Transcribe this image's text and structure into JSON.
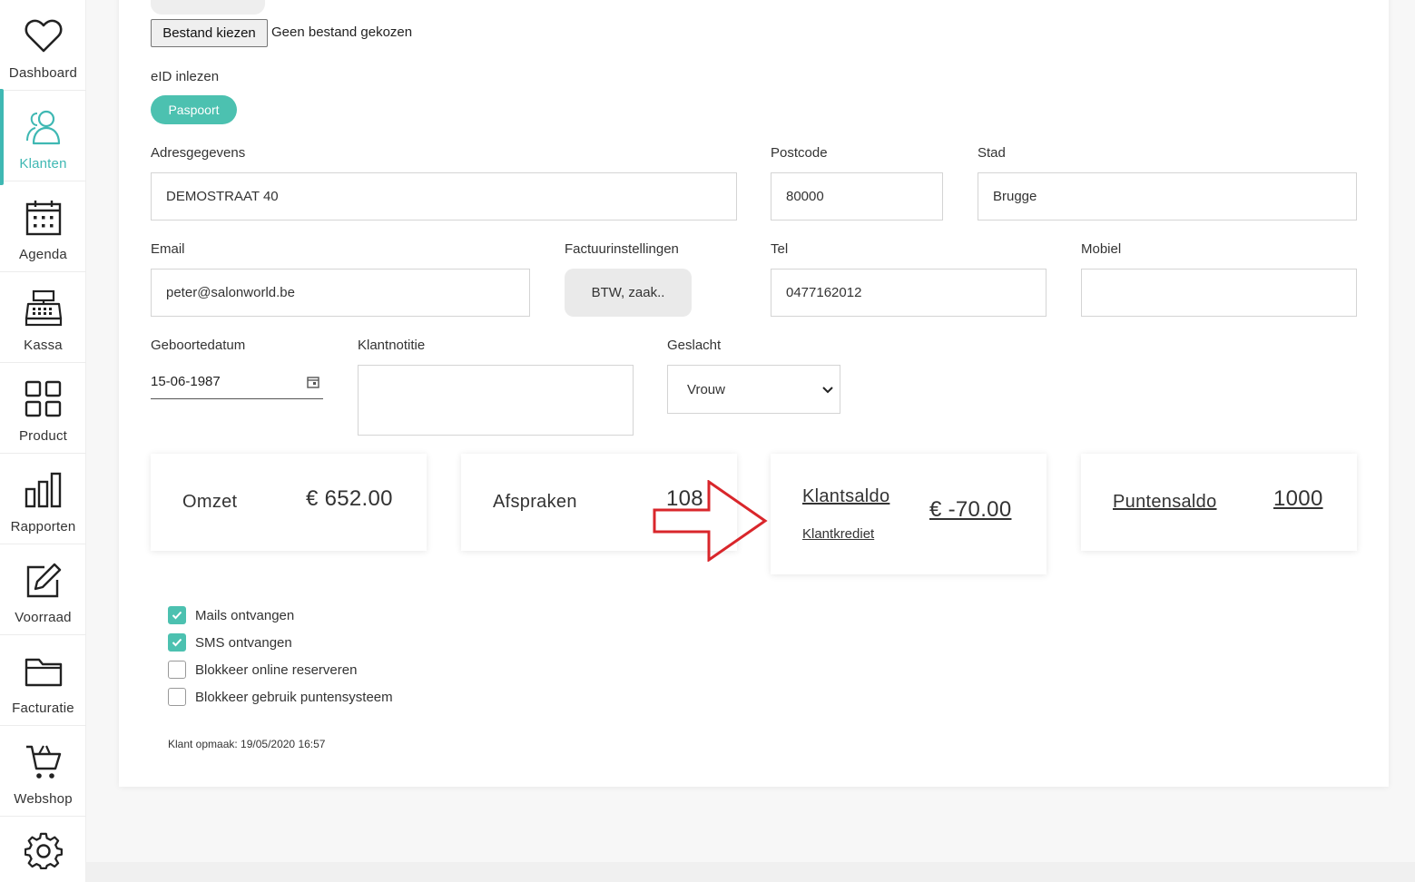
{
  "sidebar": {
    "items": [
      {
        "label": "Dashboard",
        "icon": "heart-icon"
      },
      {
        "label": "Klanten",
        "icon": "users-icon",
        "active": true
      },
      {
        "label": "Agenda",
        "icon": "calendar-icon"
      },
      {
        "label": "Kassa",
        "icon": "cash-register-icon"
      },
      {
        "label": "Product",
        "icon": "grid-icon"
      },
      {
        "label": "Rapporten",
        "icon": "bar-chart-icon"
      },
      {
        "label": "Voorraad",
        "icon": "edit-icon"
      },
      {
        "label": "Facturatie",
        "icon": "folder-icon"
      },
      {
        "label": "Webshop",
        "icon": "cart-icon"
      },
      {
        "label": "",
        "icon": "gear-icon"
      }
    ],
    "accent_color": "#3fb8b3"
  },
  "file_upload": {
    "button_label": "Bestand kiezen",
    "status": "Geen bestand gekozen"
  },
  "eid": {
    "label": "eID inlezen",
    "button_label": "Paspoort",
    "button_color": "#4cc1b0"
  },
  "form": {
    "address_label": "Adresgegevens",
    "address_value": "DEMOSTRAAT 40",
    "postcode_label": "Postcode",
    "postcode_value": "80000",
    "city_label": "Stad",
    "city_value": "Brugge",
    "email_label": "Email",
    "email_value": "peter@salonworld.be",
    "invoice_label": "Factuurinstellingen",
    "invoice_button": "BTW, zaak..",
    "tel_label": "Tel",
    "tel_value": "0477162012",
    "mobile_label": "Mobiel",
    "mobile_value": "",
    "birthdate_label": "Geboortedatum",
    "birthdate_value": "15-06-1987",
    "note_label": "Klantnotitie",
    "note_value": "",
    "gender_label": "Geslacht",
    "gender_value": "Vrouw"
  },
  "stats": {
    "turnover_label": "Omzet",
    "turnover_value": "€ 652.00",
    "appointments_label": "Afspraken",
    "appointments_value": "108",
    "balance_label": "Klantsaldo",
    "balance_value": "€ -70.00",
    "credit_link": "Klantkrediet",
    "points_label": "Puntensaldo",
    "points_value": "1000"
  },
  "options": [
    {
      "label": "Mails ontvangen",
      "checked": true
    },
    {
      "label": "SMS ontvangen",
      "checked": true
    },
    {
      "label": "Blokkeer online reserveren",
      "checked": false
    },
    {
      "label": "Blokkeer gebruik puntensysteem",
      "checked": false
    }
  ],
  "meta": {
    "created": "Klant opmaak: 19/05/2020 16:57"
  },
  "annotation_arrow_color": "#d9262b"
}
